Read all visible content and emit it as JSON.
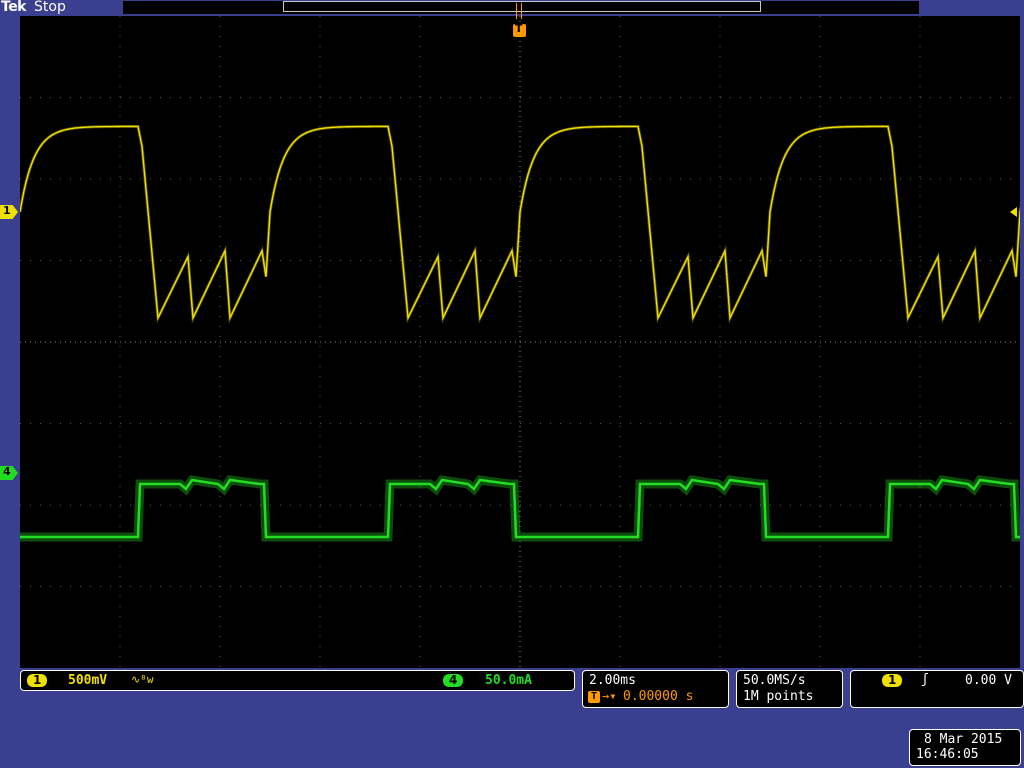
{
  "header": {
    "brand": "Tek",
    "acq_state": "Stop",
    "trigger_marker": "T"
  },
  "colors": {
    "ch1": "#f0e000",
    "ch4": "#22dd22",
    "trigger": "#ff9900",
    "panel": "#3a3f8f"
  },
  "channels": {
    "ch1": {
      "marker": "1",
      "scale": "500mV",
      "coupling_icon": "bandwidth-limit-icon"
    },
    "ch4": {
      "marker": "4",
      "scale": "50.0mA"
    }
  },
  "timebase": {
    "scale": "2.00ms",
    "trigger_symbol": "T",
    "delay": "0.00000 s"
  },
  "acquisition": {
    "rate": "50.0MS/s",
    "length": "1M points"
  },
  "trigger": {
    "source": "1",
    "slope_icon": "rising-edge-icon",
    "level": "0.00 V"
  },
  "datetime": {
    "date": "8 Mar 2015",
    "time": "16:46:05"
  },
  "chart_data": {
    "type": "line",
    "grid": {
      "x_divisions": 10,
      "y_divisions": 8
    },
    "x_unit": "ms",
    "x_range": [
      -10,
      10
    ],
    "series": [
      {
        "name": "1",
        "unit": "V",
        "scale_per_div": 0.5,
        "period_ms": 5.0,
        "description_values": {
          "high_level_divs_above_ref": 1.05,
          "ripple_low_divs_below_ref": -1.3,
          "ripple_high_divs_below_ref": -0.5
        }
      },
      {
        "name": "4",
        "unit": "mA",
        "scale_per_div": 50,
        "period_ms": 5.0,
        "description_values": {
          "high_level_divs_below_ref": -0.1,
          "low_level_divs_below_ref": -1.25
        }
      }
    ]
  }
}
